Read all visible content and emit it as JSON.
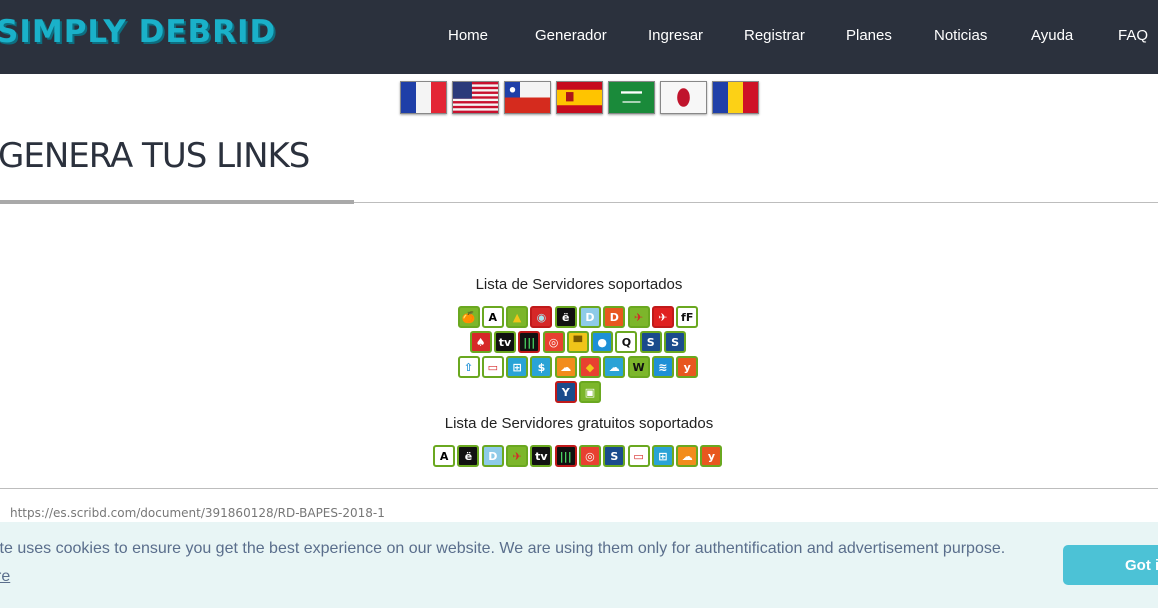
{
  "header": {
    "logo": "SIMPLY DEBRID",
    "nav": [
      {
        "label": "Home"
      },
      {
        "label": "Generador"
      },
      {
        "label": "Ingresar"
      },
      {
        "label": "Registrar"
      },
      {
        "label": "Planes"
      },
      {
        "label": "Noticias"
      },
      {
        "label": "Ayuda"
      },
      {
        "label": "FAQ"
      }
    ]
  },
  "flags": [
    "flag-france",
    "flag-usa",
    "flag-chile",
    "flag-spain",
    "flag-saudi-arabia",
    "flag-japan",
    "flag-romania"
  ],
  "main": {
    "title": "GENERA TUS LINKS",
    "supported_heading": "Lista de Servidores soportados",
    "free_heading": "Lista de Servidores gratuitos soportados",
    "supported_rows": [
      [
        {
          "glyph": "🍊",
          "bg": "#7cb62b",
          "border": "#6aa820"
        },
        {
          "glyph": "A",
          "bg": "#ffffff",
          "border": "#6aa820",
          "fg": "#000"
        },
        {
          "glyph": "▲",
          "bg": "#7cb62b",
          "border": "#6aa820",
          "fg": "#f0c419"
        },
        {
          "glyph": "◉",
          "bg": "#d62828",
          "border": "#c01a1a",
          "fg": "#a8e6f0"
        },
        {
          "glyph": "ë",
          "bg": "#111111",
          "border": "#6aa820"
        },
        {
          "glyph": "D",
          "bg": "#8ecbe8",
          "border": "#6aa820"
        },
        {
          "glyph": "D",
          "bg": "#e8571f",
          "border": "#6aa820"
        },
        {
          "glyph": "✈",
          "bg": "#7cb62b",
          "border": "#6aa820",
          "fg": "#d62828"
        },
        {
          "glyph": "✈",
          "bg": "#e02020",
          "border": "#c01a1a"
        },
        {
          "glyph": "fF",
          "bg": "#ffffff",
          "border": "#6aa820",
          "fg": "#111"
        }
      ],
      [
        {
          "glyph": "♠",
          "bg": "#d62828",
          "border": "#6aa820"
        },
        {
          "glyph": "tv",
          "bg": "#111111",
          "border": "#6aa820"
        },
        {
          "glyph": "|||",
          "bg": "#111111",
          "border": "#c01a1a",
          "fg": "#4cd964"
        },
        {
          "glyph": "◎",
          "bg": "#e84030",
          "border": "#6aa820"
        },
        {
          "glyph": "▀",
          "bg": "#f0c419",
          "border": "#6aa820",
          "fg": "#7a5a00"
        },
        {
          "glyph": "●",
          "bg": "#1e90d6",
          "border": "#6aa820"
        },
        {
          "glyph": "Q",
          "bg": "#ffffff",
          "border": "#6aa820",
          "fg": "#111"
        },
        {
          "glyph": "S",
          "bg": "#1a4b8c",
          "border": "#6aa820"
        },
        {
          "glyph": "S",
          "bg": "#1a4b8c",
          "border": "#6aa820"
        }
      ],
      [
        {
          "glyph": "⇧",
          "bg": "#ffffff",
          "border": "#6aa820",
          "fg": "#1e90d6"
        },
        {
          "glyph": "▭",
          "bg": "#ffffff",
          "border": "#6aa820",
          "fg": "#d62828"
        },
        {
          "glyph": "⊞",
          "bg": "#2aa3d6",
          "border": "#6aa820"
        },
        {
          "glyph": "$",
          "bg": "#2aa3d6",
          "border": "#6aa820"
        },
        {
          "glyph": "☁",
          "bg": "#f28c1c",
          "border": "#6aa820"
        },
        {
          "glyph": "◆",
          "bg": "#e84030",
          "border": "#6aa820",
          "fg": "#f0c419"
        },
        {
          "glyph": "☁",
          "bg": "#2aa3d6",
          "border": "#6aa820"
        },
        {
          "glyph": "W",
          "bg": "#7cb62b",
          "border": "#6aa820",
          "fg": "#111"
        },
        {
          "glyph": "≋",
          "bg": "#1e90d6",
          "border": "#6aa820"
        },
        {
          "glyph": "y",
          "bg": "#e8571f",
          "border": "#6aa820"
        }
      ],
      [
        {
          "glyph": "Y",
          "bg": "#1a4b8c",
          "border": "#c01a1a"
        },
        {
          "glyph": "▣",
          "bg": "#7cb62b",
          "border": "#6aa820"
        }
      ]
    ],
    "free_row": [
      {
        "glyph": "A",
        "bg": "#ffffff",
        "border": "#6aa820",
        "fg": "#000"
      },
      {
        "glyph": "ë",
        "bg": "#111111",
        "border": "#6aa820"
      },
      {
        "glyph": "D",
        "bg": "#8ecbe8",
        "border": "#6aa820"
      },
      {
        "glyph": "✈",
        "bg": "#7cb62b",
        "border": "#6aa820",
        "fg": "#d62828"
      },
      {
        "glyph": "tv",
        "bg": "#111111",
        "border": "#6aa820"
      },
      {
        "glyph": "|||",
        "bg": "#111111",
        "border": "#c01a1a",
        "fg": "#4cd964"
      },
      {
        "glyph": "◎",
        "bg": "#e84030",
        "border": "#6aa820"
      },
      {
        "glyph": "S",
        "bg": "#1a4b8c",
        "border": "#6aa820"
      },
      {
        "glyph": "▭",
        "bg": "#ffffff",
        "border": "#6aa820",
        "fg": "#d62828"
      },
      {
        "glyph": "⊞",
        "bg": "#2aa3d6",
        "border": "#6aa820"
      },
      {
        "glyph": "☁",
        "bg": "#f28c1c",
        "border": "#6aa820"
      },
      {
        "glyph": "y",
        "bg": "#e8571f",
        "border": "#6aa820"
      }
    ],
    "current_link": "https://es.scribd.com/document/391860128/RD-BAPES-2018-1"
  },
  "cookie": {
    "text": "ite uses cookies to ensure you get the best experience on our website. We are using them only for authentification and advertisement purpose.",
    "more": "re",
    "button": "Got i"
  },
  "colors": {
    "header_bg": "#2b313d",
    "logo": "#1ab1c9",
    "cookie_bg": "#e8f5f5",
    "cookie_button": "#4cc2d6"
  }
}
